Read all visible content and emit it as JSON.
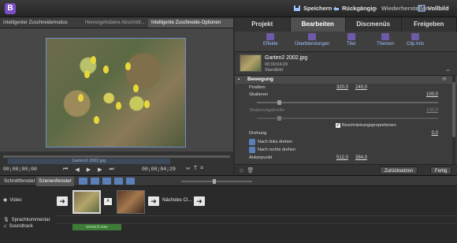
{
  "toolbar": {
    "app_logo": "B",
    "save": "Speichern",
    "undo": "Rückgängig",
    "redo": "Wiederherstellen",
    "fullscreen": "Vollbild"
  },
  "monitor": {
    "tabs": [
      "Intelligenter Zuschneidemodus",
      "Hervorgehobene Abschnitt...",
      "Intelligente Zuschneide-Optionen"
    ],
    "scrub_clip_label": "Garten2 2002.jpg",
    "timecode_left": "00;00;00;00",
    "timecode_right": "00;00;04;29"
  },
  "panel": {
    "tabs": [
      "Projekt",
      "Bearbeiten",
      "Discmenüs",
      "Freigeben"
    ],
    "active_tab": "Bearbeiten",
    "subtools": [
      "Effekte",
      "Überblendungen",
      "Titel",
      "Themen",
      "Clip Arts"
    ],
    "clip": {
      "name": "Garten2 2002.jpg",
      "duration": "00;00;04;29",
      "type": "Standbild"
    },
    "section": "Bewegung",
    "properties": {
      "position_label": "Position",
      "position_x": "320,0",
      "position_y": "240,0",
      "scale_label": "Skalieren",
      "scale_value": "100,0",
      "scale_width_label": "Skalierungsbreite",
      "scale_width_value": "100,0",
      "constrain_label": "Beschränkungsproportionen",
      "constrain_checked": true,
      "rotation_label": "Drehung",
      "rotation_value": "0,0",
      "rotate_left": "Nach links drehen",
      "rotate_right": "Nach rechts drehen",
      "anchor_label": "Ankerpunkt",
      "anchor_x": "512,0",
      "anchor_y": "384,0"
    },
    "reset_button": "Zurücksetzen",
    "done_button": "Fertig"
  },
  "timeline": {
    "tabs": [
      "Schnittfenster",
      "Szenenfenster"
    ],
    "active_tab": "Szenenfenster",
    "tracks": {
      "video": "Video",
      "narration": "Sprachkommentar",
      "soundtrack": "Soundtrack"
    },
    "next_scene_label": "Nächstes Cl...",
    "sound_clip": "wonach.wav"
  }
}
